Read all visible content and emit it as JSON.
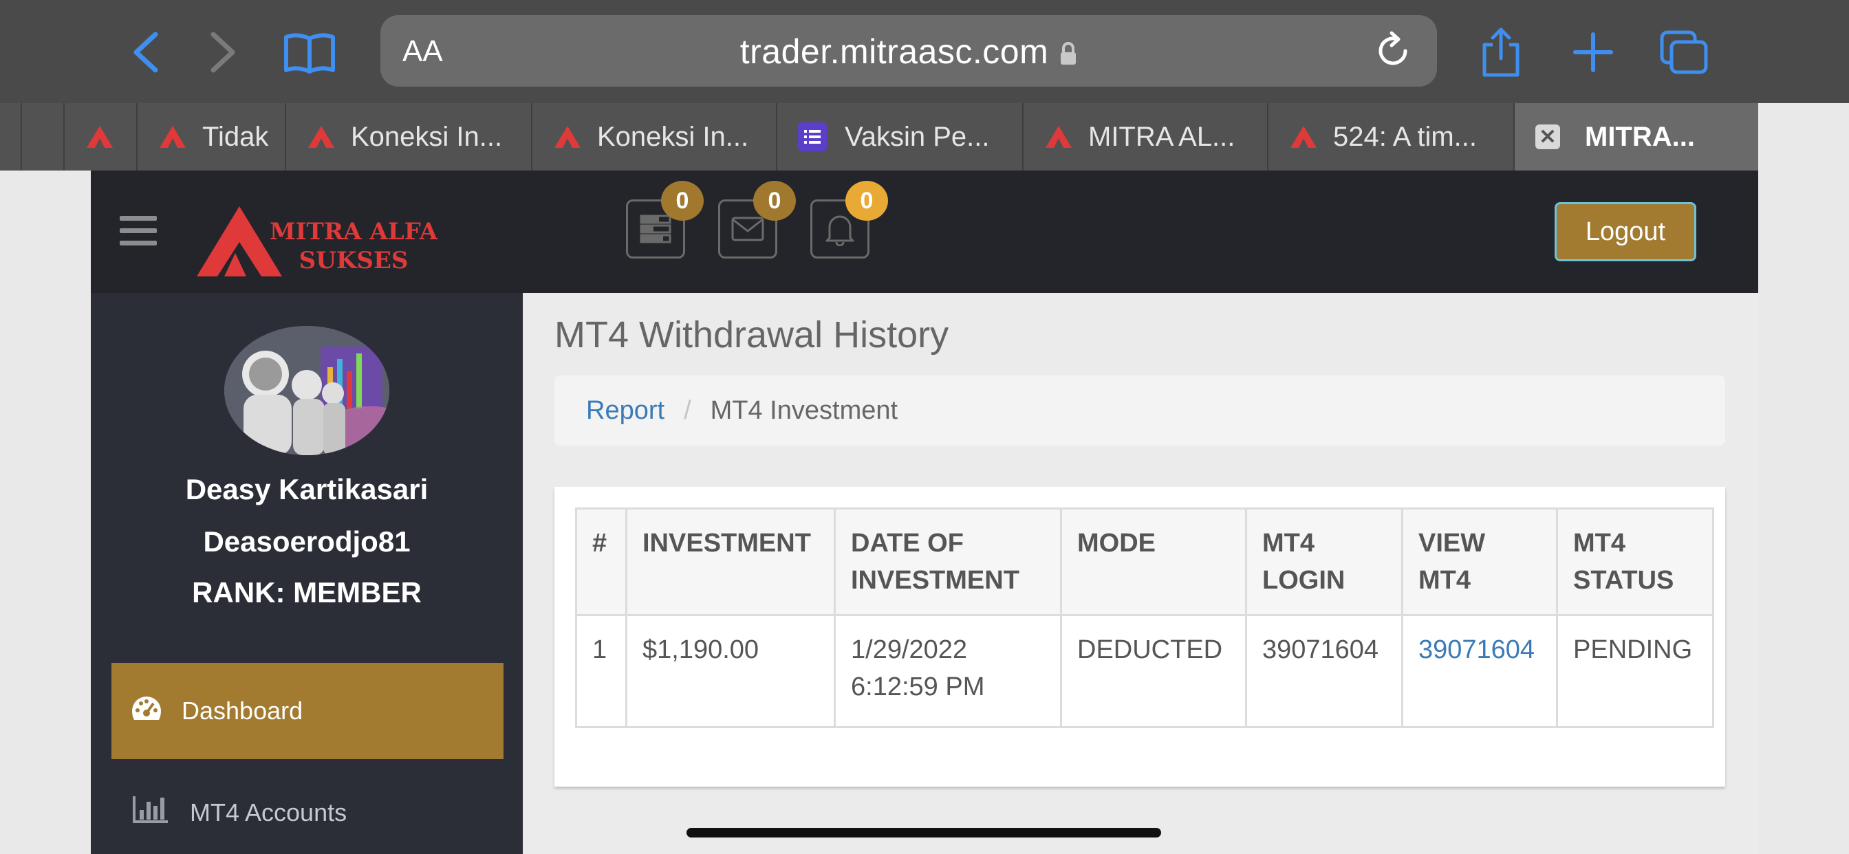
{
  "browser": {
    "aa_label": "AA",
    "url": "trader.mitraasc.com",
    "tabs": [
      {
        "title": ""
      },
      {
        "title": "Tidak"
      },
      {
        "title": "Koneksi In..."
      },
      {
        "title": "Koneksi In..."
      },
      {
        "title": "Vaksin Pe..."
      },
      {
        "title": "MITRA AL..."
      },
      {
        "title": "524: A tim..."
      },
      {
        "title": "MITRA..."
      }
    ]
  },
  "header": {
    "brand_line1": "MITRA ALFA",
    "brand_line2": "SUKSES",
    "badges": {
      "tasks": "0",
      "mail": "0",
      "notifications": "0"
    },
    "logout_label": "Logout"
  },
  "sidebar": {
    "user_name": "Deasy Kartikasari",
    "username": "Deasoerodjo81",
    "rank": "RANK: MEMBER",
    "nav": [
      {
        "label": "Dashboard",
        "icon": "dashboard-icon",
        "active": true
      },
      {
        "label": "MT4 Accounts",
        "icon": "bar-chart-icon",
        "active": false
      }
    ]
  },
  "main": {
    "title": "MT4 Withdrawal History",
    "breadcrumb": {
      "link": "Report",
      "current": "MT4 Investment"
    },
    "table": {
      "headers": [
        "#",
        "INVESTMENT",
        "DATE OF INVESTMENT",
        "MODE",
        "MT4 LOGIN",
        "VIEW MT4",
        "MT4 STATUS"
      ],
      "rows": [
        {
          "num": "1",
          "investment": "$1,190.00",
          "date": "1/29/2022",
          "time": "6:12:59 PM",
          "mode": "DEDUCTED",
          "login": "39071604",
          "view": "39071604",
          "status": "PENDING"
        }
      ]
    }
  },
  "colors": {
    "accent": "#a27a30",
    "sidebar": "#2b2e37",
    "header": "#24252a",
    "link": "#3a7ab7",
    "brand_red": "#e0393a"
  }
}
